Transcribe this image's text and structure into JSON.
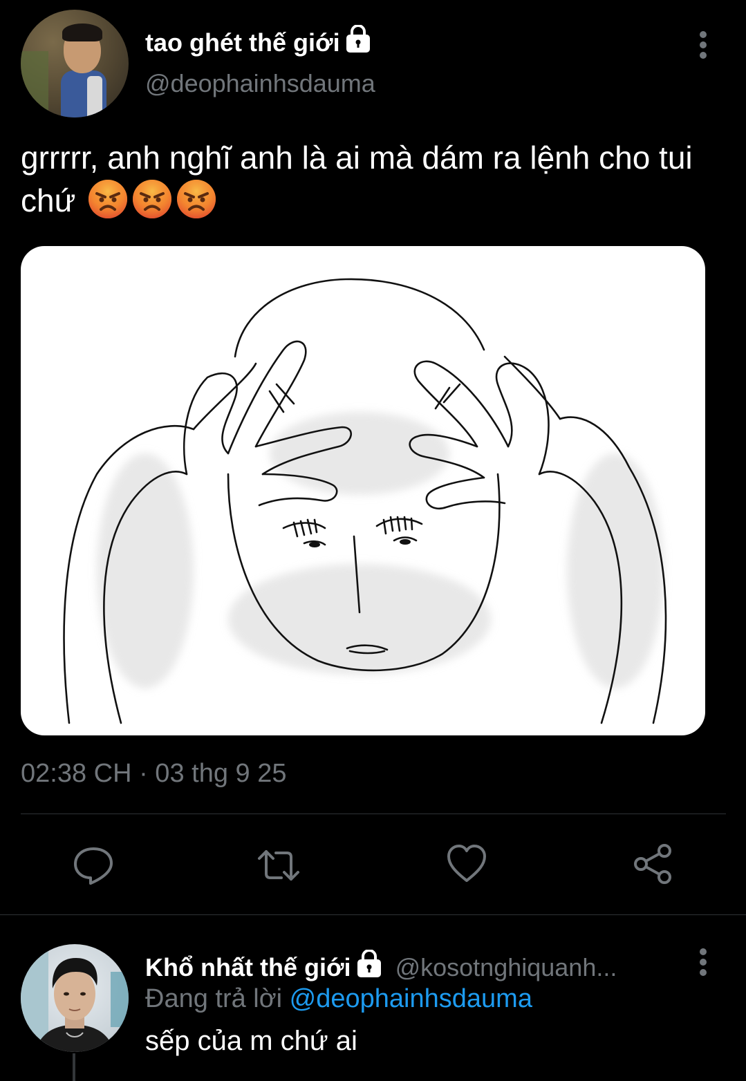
{
  "tweet": {
    "author": {
      "display_name": "tao ghét thế giới",
      "handle": "@deophainhsdauma",
      "protected_icon": "lock-icon",
      "avatar": "avatar-child-photo"
    },
    "menu_icon": "vertical-ellipsis-icon",
    "text": "grrrrr, anh nghĩ anh là ai mà dám ra lệnh cho tui chứ",
    "emojis": [
      "angry-face-emoji",
      "angry-face-emoji",
      "angry-face-emoji"
    ],
    "media": {
      "description_icon": "stressed-bald-figure-drawing",
      "background": "#ffffff"
    },
    "timestamp": "02:38 CH · 03 thg 9 25",
    "actions": [
      {
        "name": "reply",
        "icon": "reply-bubble-icon"
      },
      {
        "name": "retweet",
        "icon": "retweet-icon"
      },
      {
        "name": "like",
        "icon": "heart-icon"
      },
      {
        "name": "share",
        "icon": "share-icon"
      }
    ]
  },
  "reply": {
    "author": {
      "display_name": "Khổ nhất thế giới",
      "handle": "@kosotnghiquanh...",
      "protected_icon": "lock-icon",
      "avatar": "avatar-young-man-photo"
    },
    "replying_prefix": "Đang trả lời",
    "replying_to": "@deophainhsdauma",
    "menu_icon": "vertical-ellipsis-icon",
    "text": "sếp của m chứ ai"
  },
  "colors": {
    "background": "#000000",
    "primary_text": "#ffffff",
    "secondary_text": "#71767b",
    "link": "#1d9bf0",
    "divider": "#2f3336",
    "emoji_face": "#f7a63a",
    "emoji_red": "#e0442f"
  }
}
